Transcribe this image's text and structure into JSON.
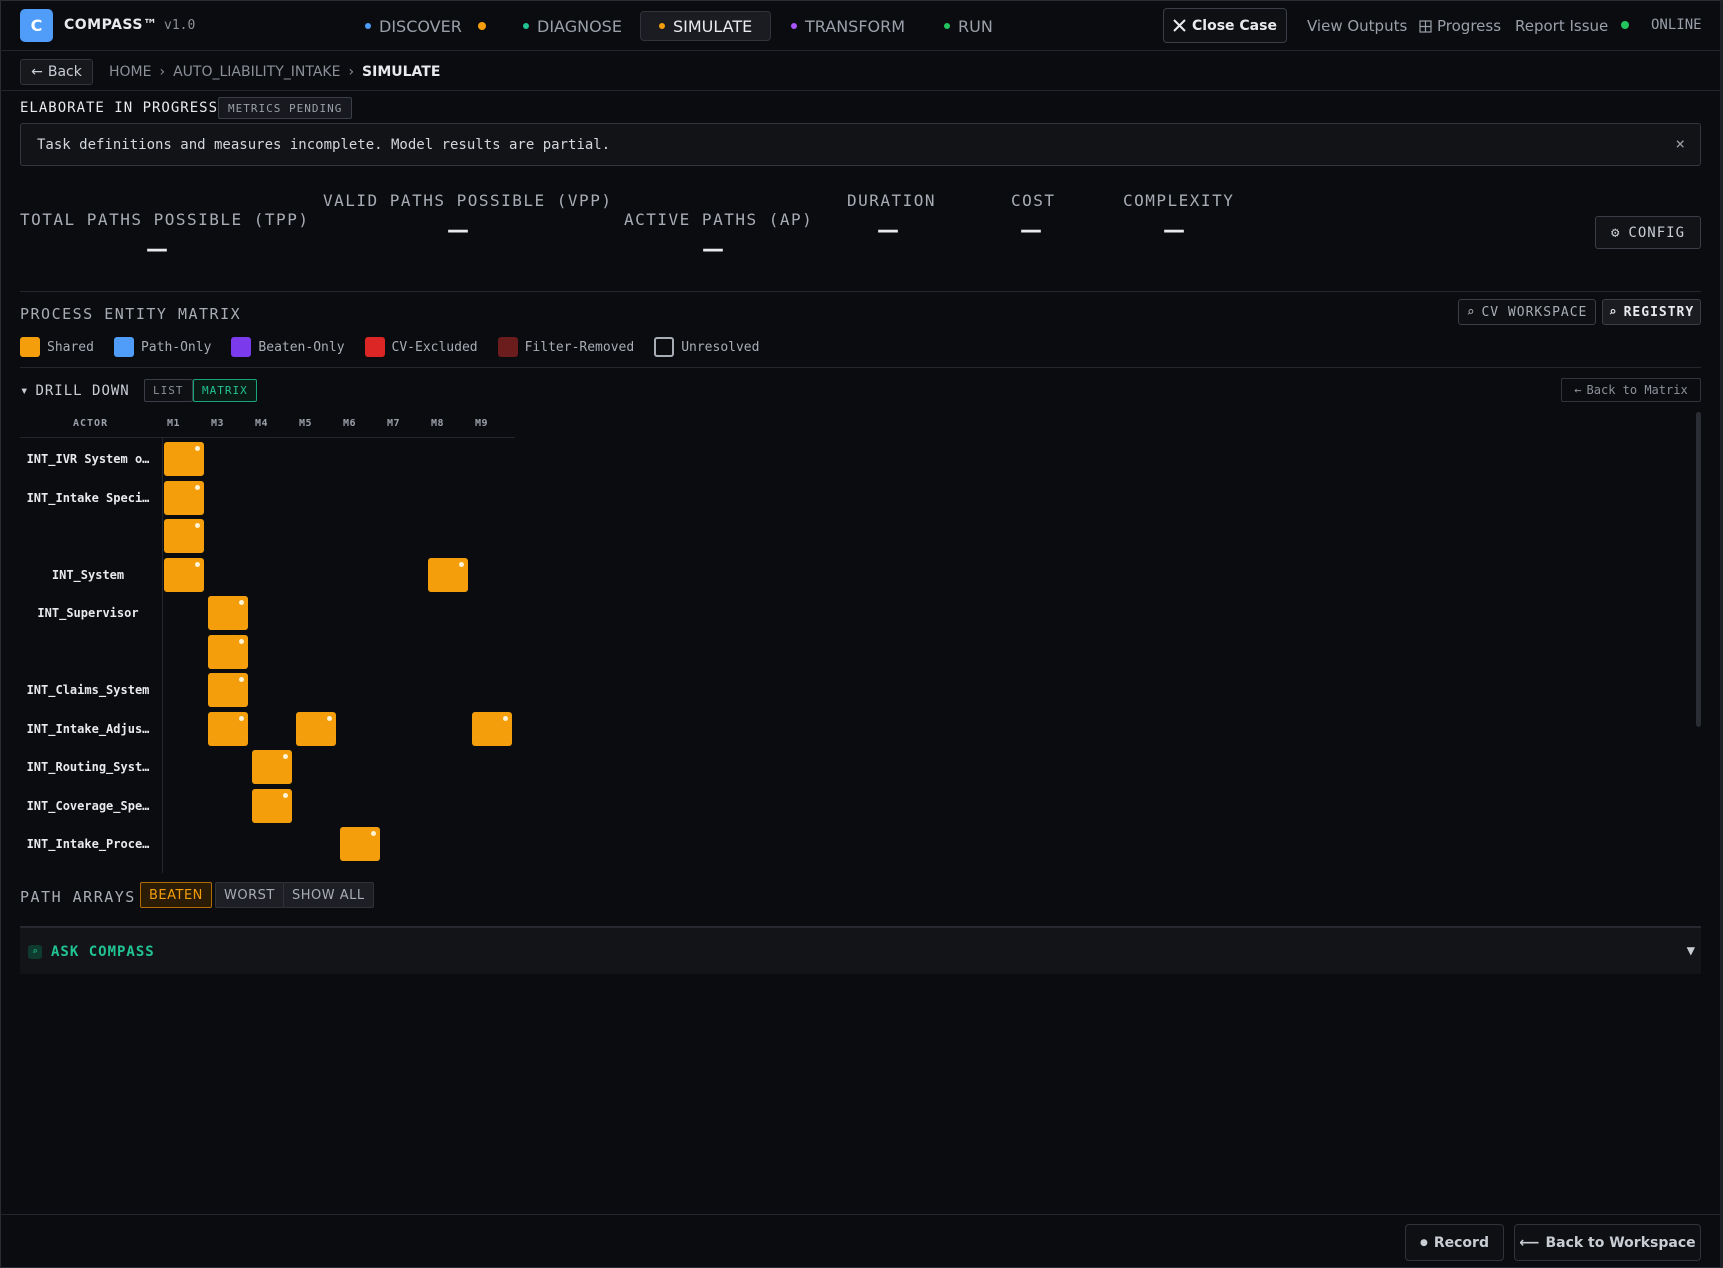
{
  "app": {
    "logo_letter": "C",
    "brand": "COMPASS™",
    "version": "v1.0"
  },
  "nav": {
    "tabs": [
      {
        "label": "DISCOVER",
        "dot_color": "#4f9cf9",
        "badge_color": "#f59e0b"
      },
      {
        "label": "DIAGNOSE",
        "dot_color": "#22c493"
      },
      {
        "label": "SIMULATE",
        "dot_color": "#f59e0b",
        "active": true
      },
      {
        "label": "TRANSFORM",
        "dot_color": "#a855f7"
      },
      {
        "label": "RUN",
        "dot_color": "#22c55e"
      }
    ],
    "close_case": "Close Case",
    "view_outputs": "View Outputs",
    "progress": "Progress",
    "report_issue": "Report Issue",
    "online": "ONLINE",
    "online_color": "#22c55e"
  },
  "breadcrumb": {
    "back": "Back",
    "items": [
      "HOME",
      "AUTO_LIABILITY_INTAKE",
      "SIMULATE"
    ]
  },
  "status": {
    "title": "ELABORATE IN PROGRESS",
    "badge": "METRICS PENDING",
    "alert": "Task definitions and measures incomplete. Model results are partial.",
    "alert_close": "×"
  },
  "metrics": [
    {
      "label": "TOTAL PATHS POSSIBLE (TPP)",
      "value": "—"
    },
    {
      "label": "VALID PATHS POSSIBLE (VPP)",
      "value": "—"
    },
    {
      "label": "ACTIVE PATHS (AP)",
      "value": "—"
    },
    {
      "label": "DURATION",
      "value": "—"
    },
    {
      "label": "COST",
      "value": "—"
    },
    {
      "label": "COMPLEXITY",
      "value": "—"
    }
  ],
  "config": "CONFIG",
  "matrix": {
    "title": "PROCESS ENTITY MATRIX",
    "cv_workspace": "CV WORKSPACE",
    "registry": "REGISTRY",
    "legend": [
      {
        "label": "Shared",
        "color": "#f59e0b"
      },
      {
        "label": "Path-Only",
        "color": "#4f9cf9"
      },
      {
        "label": "Beaten-Only",
        "color": "#7c3aed"
      },
      {
        "label": "CV-Excluded",
        "color": "#dc2626"
      },
      {
        "label": "Filter-Removed",
        "color": "#6b1d1d"
      },
      {
        "label": "Unresolved",
        "color": "outline"
      }
    ],
    "drill_down": "DRILL DOWN",
    "list": "LIST",
    "matrix_toggle": "MATRIX",
    "back_to_matrix": "Back to Matrix",
    "actor_header": "ACTOR",
    "columns": [
      "M1",
      "M3",
      "M4",
      "M5",
      "M6",
      "M7",
      "M8",
      "M9"
    ],
    "rows": [
      {
        "actor": "INT_IVR System o…",
        "cells": [
          "M1"
        ]
      },
      {
        "actor": "INT_Intake Speci…",
        "cells": [
          "M1"
        ]
      },
      {
        "actor": "",
        "cells": [
          "M1"
        ]
      },
      {
        "actor": "INT_System",
        "cells": [
          "M1",
          "M8"
        ]
      },
      {
        "actor": "INT_Supervisor",
        "cells": [
          "M3"
        ]
      },
      {
        "actor": "",
        "cells": [
          "M3"
        ]
      },
      {
        "actor": "INT_Claims_System",
        "cells": [
          "M3"
        ]
      },
      {
        "actor": "INT_Intake_Adjus…",
        "cells": [
          "M3",
          "M5",
          "M9"
        ]
      },
      {
        "actor": "INT_Routing_Syst…",
        "cells": [
          "M4"
        ]
      },
      {
        "actor": "INT_Coverage_Spe…",
        "cells": [
          "M4"
        ]
      },
      {
        "actor": "INT_Intake_Proce…",
        "cells": [
          "M6"
        ]
      }
    ]
  },
  "path_arrays": {
    "title": "PATH ARRAYS",
    "buttons": [
      "BEATEN",
      "WORST",
      "SHOW ALL"
    ]
  },
  "ask": {
    "label": "ASK COMPASS"
  },
  "footer": {
    "record": "Record",
    "back_workspace": "Back to Workspace"
  }
}
